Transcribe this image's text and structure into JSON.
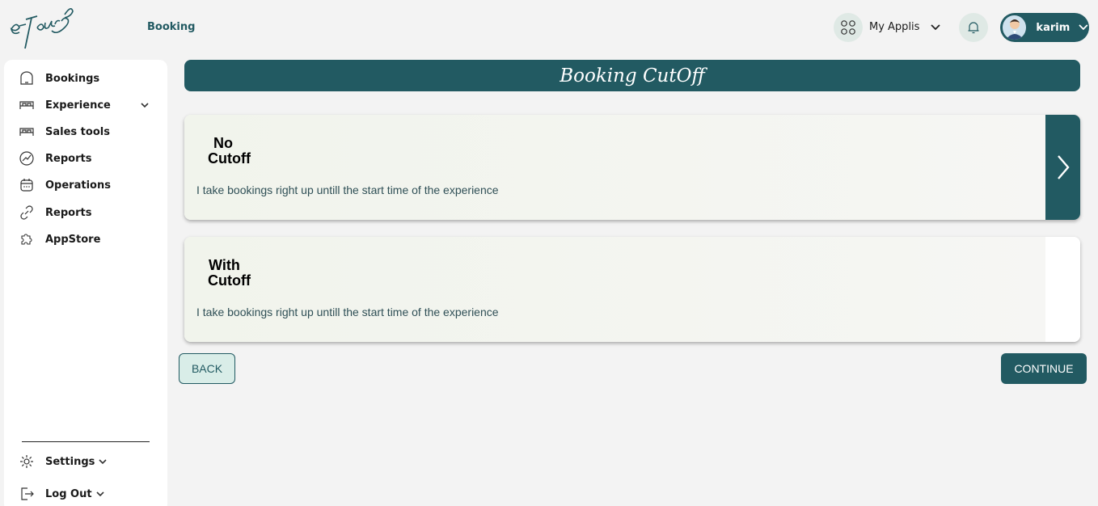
{
  "brand": {
    "logo_text": "e-TourS",
    "accent": "#225a62",
    "accent_light": "#dfe9e5"
  },
  "topbar": {
    "section_label": "Booking",
    "apps_label": "My Applis",
    "user_name": "karim"
  },
  "sidebar": {
    "items": [
      {
        "label": "Bookings",
        "icon": "home-icon"
      },
      {
        "label": "Experience",
        "icon": "bed-icon",
        "has_chevron": true
      },
      {
        "label": "Sales tools",
        "icon": "bed-icon"
      },
      {
        "label": "Reports",
        "icon": "chart-icon"
      },
      {
        "label": "Operations",
        "icon": "calendar-icon"
      },
      {
        "label": "Reports",
        "icon": "link-icon"
      },
      {
        "label": "AppStore",
        "icon": "puzzle-icon"
      }
    ],
    "footer": [
      {
        "label": "Settings",
        "icon": "gear-icon"
      },
      {
        "label": "Log Out",
        "icon": "logout-icon"
      }
    ]
  },
  "main": {
    "banner_title": "Booking CutOff",
    "options": [
      {
        "title_line1": "No",
        "title_line2": "Cutoff",
        "description": "I take bookings right up untill the start time of the experience",
        "selected": true
      },
      {
        "title_line1": "With",
        "title_line2": "Cutoff",
        "description": "I take bookings right up untill the start time of the experience",
        "selected": false
      }
    ],
    "back_label": "BACK",
    "continue_label": "CONTINUE"
  }
}
